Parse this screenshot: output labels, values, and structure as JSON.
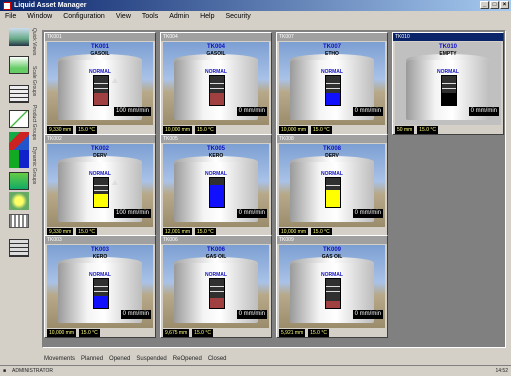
{
  "window": {
    "title": "Liquid Asset Manager"
  },
  "menu": [
    "File",
    "Window",
    "Configuration",
    "View",
    "Tools",
    "Admin",
    "Help",
    "Security"
  ],
  "toolbar": {
    "labels": [
      "Quick Views",
      "Scale Groups",
      "Product Groups",
      "Dynamic Groups"
    ]
  },
  "tanks": [
    {
      "id": "TK001",
      "title": "TK001",
      "product": "GASOIL",
      "state": "NORMAL",
      "level": "9,330 mm",
      "temp": "15.0 °C",
      "flow": "100 mm/min",
      "fill_color": "#a04040",
      "fill_pct": 0.4,
      "arrow": true,
      "active": false
    },
    {
      "id": "TK004",
      "title": "TK004",
      "product": "GASOIL",
      "state": "NORMAL",
      "level": "10,000 mm",
      "temp": "15.0 °C",
      "flow": "0 mm/min",
      "fill_color": "#a04040",
      "fill_pct": 0.4,
      "arrow": false,
      "active": false
    },
    {
      "id": "TK007",
      "title": "TK007",
      "product": "ETHO",
      "state": "NORMAL",
      "level": "10,000 mm",
      "temp": "15.0 °C",
      "flow": "0 mm/min",
      "fill_color": "#1010ff",
      "fill_pct": 0.4,
      "arrow": false,
      "active": false
    },
    {
      "id": "TK010",
      "title": "TK010",
      "product": "EMPTY",
      "state": "NORMAL",
      "level": "50 mm",
      "temp": "15.0 °C",
      "flow": "0 mm/min",
      "fill_color": "#000000",
      "fill_pct": 0.4,
      "arrow": false,
      "active": true
    },
    {
      "id": "TK002",
      "title": "TK002",
      "product": "DERV",
      "state": "NORMAL",
      "level": "9,330 mm",
      "temp": "15.0 °C",
      "flow": "100 mm/min",
      "fill_color": "#ffff00",
      "fill_pct": 0.45,
      "arrow": true,
      "active": false
    },
    {
      "id": "TK005",
      "title": "TK005",
      "product": "KERO",
      "state": "NORMAL",
      "level": "12,001 mm",
      "temp": "15.0 °C",
      "flow": "0 mm/min",
      "fill_color": "#1010ff",
      "fill_pct": 0.75,
      "arrow": false,
      "active": false
    },
    {
      "id": "TK008",
      "title": "TK008",
      "product": "DERV",
      "state": "NORMAL",
      "level": "10,000 mm",
      "temp": "15.0 °C",
      "flow": "0 mm/min",
      "fill_color": "#ffff00",
      "fill_pct": 0.6,
      "arrow": false,
      "active": false
    },
    {
      "id": "TK003",
      "title": "TK003",
      "product": "KERO",
      "state": "NORMAL",
      "level": "10,000 mm",
      "temp": "15.0 °C",
      "flow": "0 mm/min",
      "fill_color": "#1010ff",
      "fill_pct": 0.4,
      "arrow": false,
      "active": false
    },
    {
      "id": "TK006",
      "title": "TK006",
      "product": "GAS OIL",
      "state": "NORMAL",
      "level": "9,675 mm",
      "temp": "15.0 °C",
      "flow": "0 mm/min",
      "fill_color": "#a04040",
      "fill_pct": 0.35,
      "arrow": false,
      "active": false
    },
    {
      "id": "TK009",
      "title": "TK009",
      "product": "GAS OIL",
      "state": "NORMAL",
      "level": "5,921 mm",
      "temp": "15.0 °C",
      "flow": "0 mm/min",
      "fill_color": "#a04040",
      "fill_pct": 0.25,
      "arrow": false,
      "active": false
    }
  ],
  "bottom_tabs": [
    "Movements",
    "Planned",
    "Opened",
    "Suspended",
    "ReOpened",
    "Closed"
  ],
  "status": {
    "user": "ADMINISTRATOR",
    "time": "14:52"
  }
}
